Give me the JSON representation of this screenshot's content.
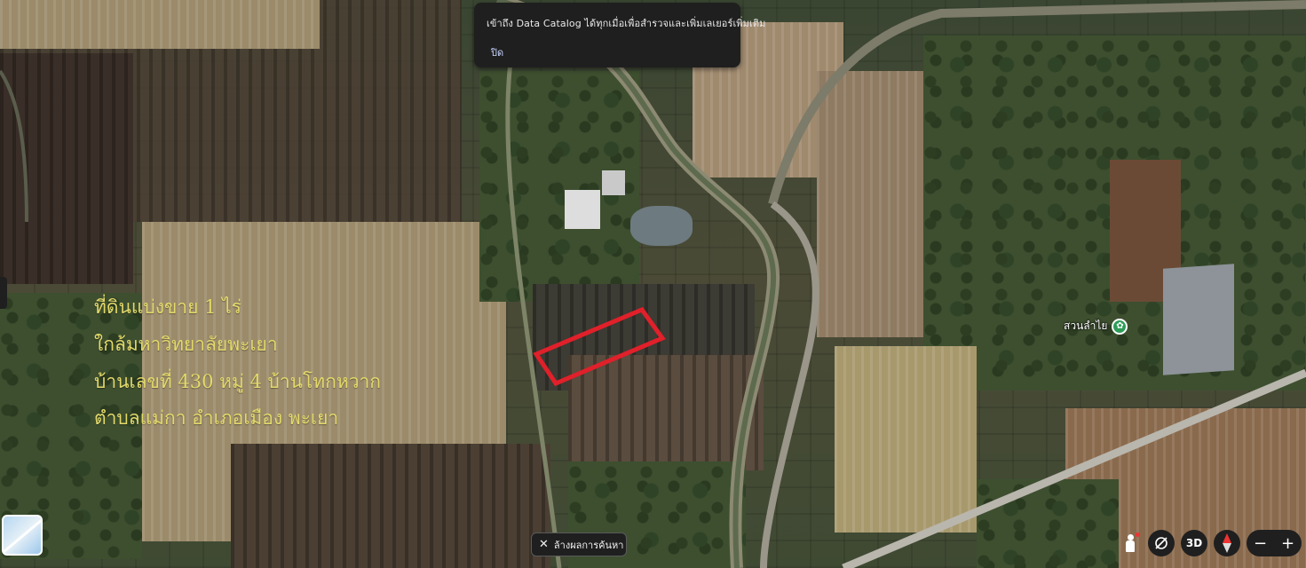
{
  "notification": {
    "message": "เข้าถึง Data Catalog ได้ทุกเมื่อเพื่อสำรวจและเพิ่มเลเยอร์เพิ่มเติม",
    "close_label": "ปิด"
  },
  "overlay_text": {
    "line1": "ที่ดินแบ่งขาย 1 ไร่",
    "line2": "ใกล้มหาวิทยาลัยพะเยา",
    "line3": "บ้านเลขที่ 430 หมู่ 4 บ้านโทกหวาก",
    "line4": "ตำบลแม่กา อำเภอเมือง พะเยา",
    "color": "#e3d96a"
  },
  "place_label": {
    "name": "สวนลำไย",
    "icon": "park-pin-icon"
  },
  "search_chip": {
    "label": "ล้างผลการค้นหา",
    "icon": "close-icon"
  },
  "controls": {
    "pegman": "pegman-icon",
    "rotate": "rotate-icon",
    "view3d_label": "3D",
    "compass": "compass-icon",
    "zoom_out": "−",
    "zoom_in": "+"
  },
  "parcel_outline_color": "#e0202a"
}
